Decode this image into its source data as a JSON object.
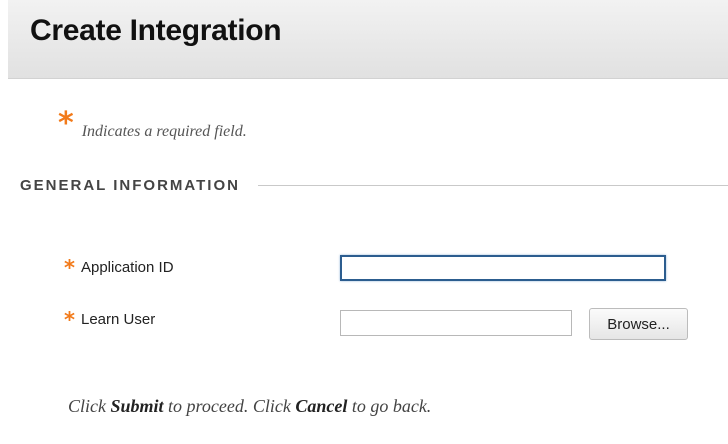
{
  "header": {
    "title": "Create Integration"
  },
  "required_note": {
    "star": "*",
    "text": "Indicates a required field."
  },
  "section": {
    "title": "GENERAL INFORMATION"
  },
  "form": {
    "application_id": {
      "label": "Application ID",
      "required_star": "*",
      "value": "",
      "focused": true
    },
    "learn_user": {
      "label": "Learn User",
      "required_star": "*",
      "value": "",
      "browse_label": "Browse..."
    }
  },
  "footer": {
    "text_1": "Click ",
    "submit_word": "Submit",
    "text_2": " to proceed. Click ",
    "cancel_word": "Cancel",
    "text_3": " to go back."
  },
  "colors": {
    "required_star": "#f27a1a",
    "focus_border": "#2c5d8f"
  }
}
